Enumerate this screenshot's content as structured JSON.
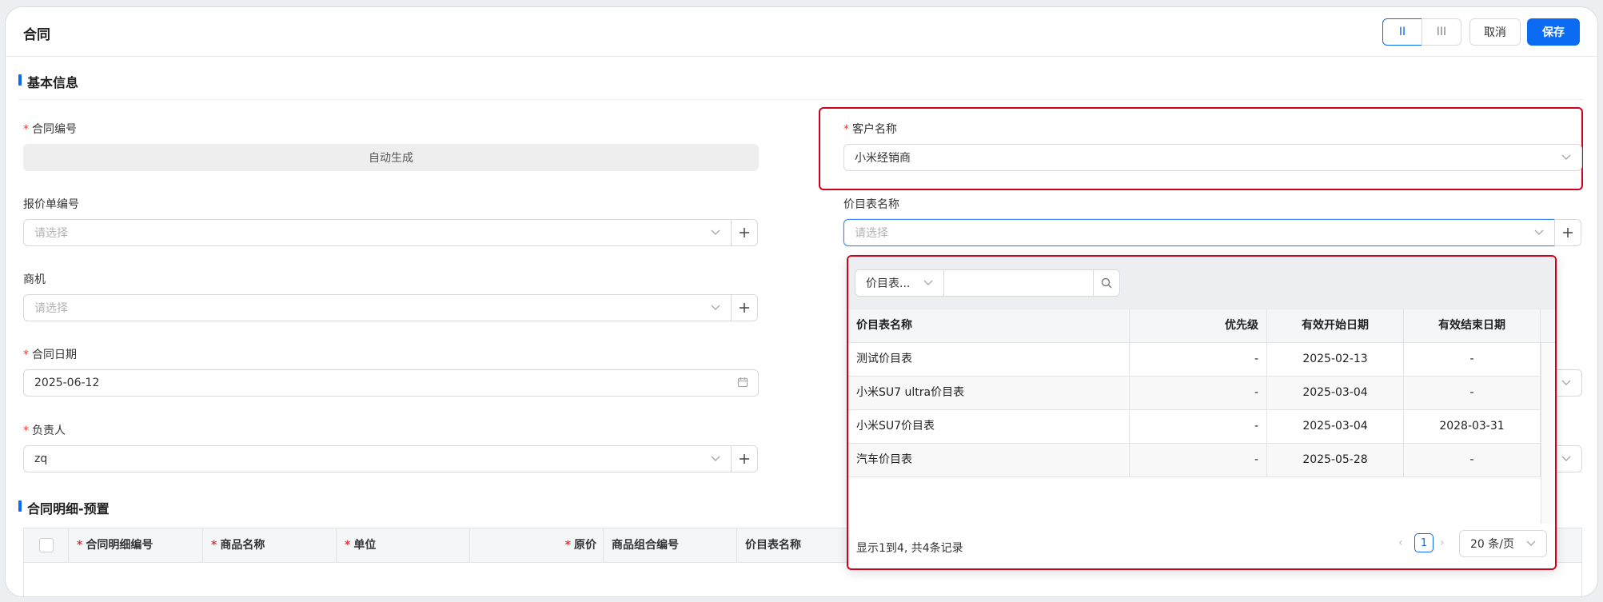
{
  "header": {
    "title": "合同",
    "layout2": "II",
    "layout3": "III",
    "cancel": "取消",
    "save": "保存"
  },
  "basic_section": {
    "title": "基本信息"
  },
  "fields": {
    "contract_no": {
      "label": "合同编号",
      "value": "自动生成"
    },
    "quote_no": {
      "label": "报价单编号",
      "placeholder": "请选择"
    },
    "opportunity": {
      "label": "商机",
      "placeholder": "请选择"
    },
    "contract_date": {
      "label": "合同日期",
      "value": "2025-06-12"
    },
    "owner": {
      "label": "负责人",
      "value": "zq"
    },
    "customer": {
      "label": "客户名称",
      "value": "小米经销商"
    },
    "pricelist": {
      "label": "价目表名称",
      "placeholder": "请选择"
    }
  },
  "detail_section": {
    "title": "合同明细-预置",
    "columns": [
      "合同明细编号",
      "商品名称",
      "单位",
      "原价",
      "商品组合编号",
      "价目表名称"
    ]
  },
  "dropdown": {
    "filter_field": "价目表...",
    "columns": [
      "价目表名称",
      "优先级",
      "有效开始日期",
      "有效结束日期"
    ],
    "rows": [
      [
        "测试价目表",
        "-",
        "2025-02-13",
        "-"
      ],
      [
        "小米SU7 ultra价目表",
        "-",
        "2025-03-04",
        "-"
      ],
      [
        "小米SU7价目表",
        "-",
        "2025-03-04",
        "2028-03-31"
      ],
      [
        "汽车价目表",
        "-",
        "2025-05-28",
        "-"
      ]
    ],
    "summary": "显示1到4, 共4条记录",
    "page": "1",
    "page_size": "20 条/页"
  }
}
